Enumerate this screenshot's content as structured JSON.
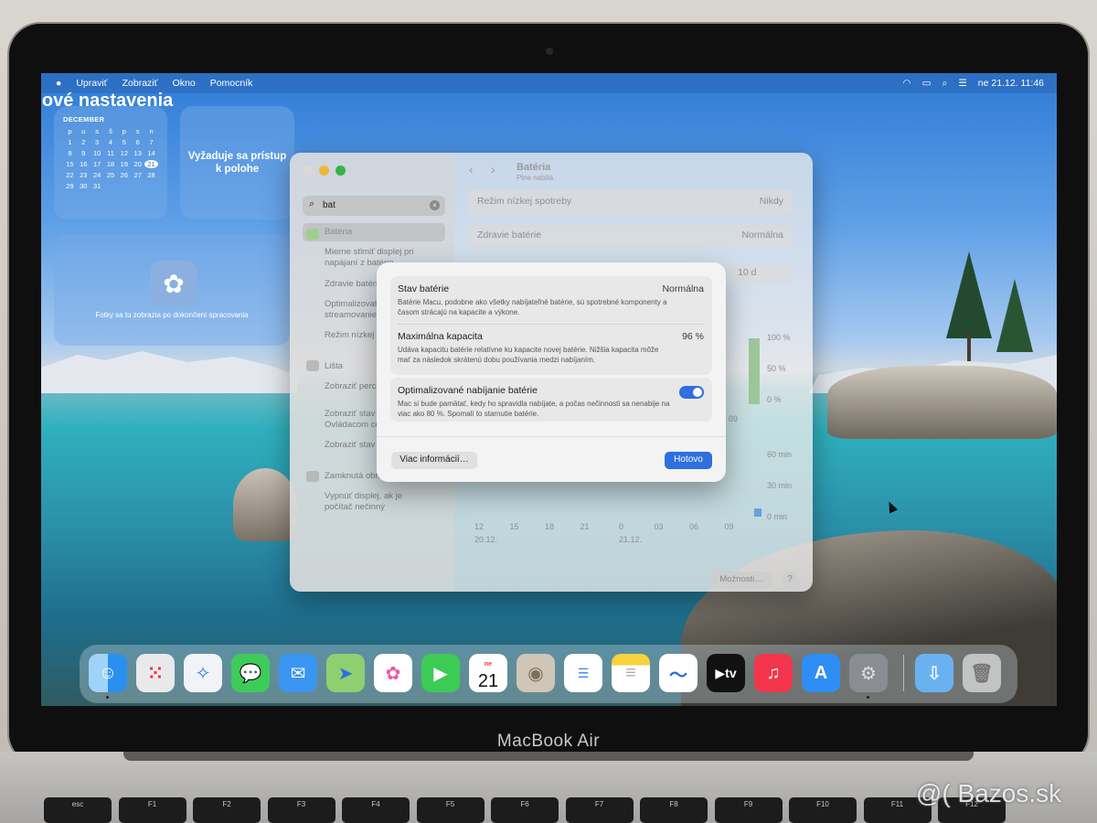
{
  "menubar": {
    "apple": "",
    "items": [
      "Systémové nastavenia",
      "Upraviť",
      "Zobraziť",
      "Okno",
      "Pomocník"
    ],
    "datetime": "ne 21.12.  11:46"
  },
  "widgets": {
    "calendar": {
      "month": "DECEMBER",
      "weekdays": [
        "p",
        "u",
        "s",
        "š",
        "p",
        "s",
        "n"
      ],
      "days": [
        "1",
        "2",
        "3",
        "4",
        "5",
        "6",
        "7",
        "8",
        "9",
        "10",
        "11",
        "12",
        "13",
        "14",
        "15",
        "16",
        "17",
        "18",
        "19",
        "20",
        "21",
        "22",
        "23",
        "24",
        "25",
        "26",
        "27",
        "28",
        "29",
        "30",
        "31"
      ],
      "today": "21"
    },
    "location": "Vyžaduje sa prístup k polohe",
    "photos": "Fotky sa tu zobrazia po dokončení spracovania"
  },
  "settings": {
    "search_value": "bat",
    "sidebar": {
      "battery": "Batéria",
      "battery_sub1": "Mierne stlmiť displej pri napájaní z batérie",
      "battery_sub2": "Zdravie batérie",
      "battery_sub3": "Optimalizovať streamovanie",
      "battery_sub4": "Režim nízkej spotreby",
      "menubar": "Lišta",
      "menubar_sub1": "Zobraziť percentá v lište",
      "menubar_sub2": "Zobraziť stav v Ovládacom centre",
      "menubar_sub3": "Zobraziť stav",
      "lock": "Zamknutá obrazovka",
      "lock_sub1": "Vypnúť displej, ak je počítač nečinný"
    },
    "header": {
      "title": "Batéria",
      "subtitle": "Plne nabitá"
    },
    "rows": {
      "low_power_label": "Režim nízkej spotreby",
      "low_power_value": "Nikdy",
      "health_label": "Zdravie batérie",
      "health_value": "Normálna",
      "range_value": "10 d"
    },
    "chart": {
      "ylabels_top": [
        "100 %",
        "50 %",
        "0 %"
      ],
      "ylabels_bottom": [
        "60 min",
        "30 min",
        "0 min"
      ],
      "xlabels": [
        "12",
        "15",
        "18",
        "21",
        "0",
        "03",
        "06",
        "09"
      ],
      "dates": [
        "20.12.",
        "21.12."
      ],
      "top_xlabel": "09"
    },
    "options_button": "Možnosti…",
    "help_button": "?"
  },
  "dialog": {
    "state_label": "Stav batérie",
    "state_value": "Normálna",
    "state_desc": "Batérie Macu, podobne ako všetky nabíjateľné batérie, sú spotrebné komponenty a časom strácajú na kapacite a výkone.",
    "capacity_label": "Maximálna kapacita",
    "capacity_value": "96 %",
    "capacity_desc": "Udáva kapacitu batérie relatívne ku kapacite novej batérie. Nižšia kapacita môže mať za následok skrátenú dobu používania medzi nabíjaním.",
    "optimized_label": "Optimalizované nabíjanie batérie",
    "optimized_desc": "Mac si bude pamätať, kedy ho spravidla nabíjate, a počas nečinnosti sa nenabije na viac ako 80 %. Spomalí to starnutie batérie.",
    "optimized_on": true,
    "more_button": "Viac informácií…",
    "done_button": "Hotovo"
  },
  "dock": {
    "apps": [
      "finder-icon",
      "launchpad-icon",
      "safari-icon",
      "messages-icon",
      "mail-icon",
      "maps-icon",
      "photos-icon",
      "facetime-icon",
      "calendar-icon",
      "contacts-icon",
      "reminders-icon",
      "notes-icon",
      "freeform-icon",
      "tv-icon",
      "music-icon",
      "app-store-icon",
      "system-settings-icon",
      "downloads-folder-icon",
      "trash-icon"
    ],
    "calendar_month": "ne",
    "calendar_day": "21",
    "tv_label": "tv"
  },
  "device": {
    "brand": "MacBook Air",
    "keys": [
      "esc",
      "F1",
      "F2",
      "F3",
      "F4",
      "F5",
      "F6",
      "F7",
      "F8",
      "F9",
      "F10",
      "F11",
      "F12"
    ]
  },
  "watermark": "@( Bazos.sk"
}
